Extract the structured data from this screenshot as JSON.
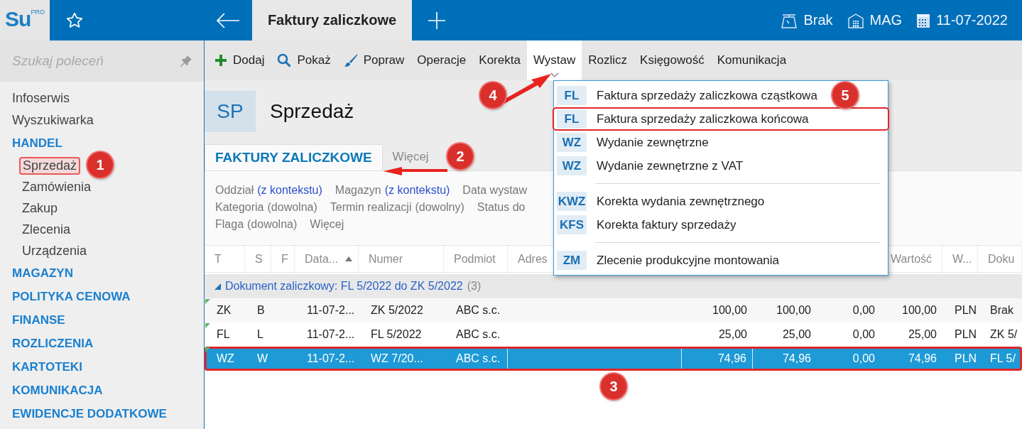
{
  "topbar": {
    "logo": {
      "text": "Su",
      "badge": "PRO"
    },
    "tab": {
      "title": "Faktury zaliczkowe",
      "selected": true
    },
    "status": [
      {
        "kind": "scale",
        "text": "Brak"
      },
      {
        "kind": "warehouse",
        "text": "MAG"
      },
      {
        "kind": "calendar",
        "text": "11-07-2022"
      }
    ]
  },
  "sidebar": {
    "search": {
      "placeholder": "Szukaj poleceń"
    },
    "items": [
      {
        "kind": "link",
        "label": "Infoserwis"
      },
      {
        "kind": "link",
        "label": "Wyszukiwarka"
      },
      {
        "kind": "section",
        "label": "HANDEL",
        "children": [
          {
            "label": "Sprzedaż",
            "selected": true
          },
          {
            "label": "Zamówienia",
            "selected": false
          },
          {
            "label": "Zakup",
            "selected": false
          },
          {
            "label": "Zlecenia",
            "selected": false
          },
          {
            "label": "Urządzenia",
            "selected": false
          }
        ]
      },
      {
        "kind": "section",
        "label": "MAGAZYN"
      },
      {
        "kind": "section",
        "label": "POLITYKA CENOWA"
      },
      {
        "kind": "section",
        "label": "FINANSE"
      },
      {
        "kind": "section",
        "label": "ROZLICZENIA"
      },
      {
        "kind": "section",
        "label": "KARTOTEKI"
      },
      {
        "kind": "section",
        "label": "KOMUNIKACJA"
      },
      {
        "kind": "section",
        "label": "EWIDENCJE DODATKOWE"
      }
    ]
  },
  "toolbar": [
    {
      "kind": "add",
      "label": "Dodaj",
      "selected": false
    },
    {
      "kind": "search",
      "label": "Pokaż",
      "selected": false
    },
    {
      "kind": "brush",
      "label": "Popraw",
      "selected": false
    },
    {
      "kind": "plain",
      "label": "Operacje",
      "selected": false
    },
    {
      "kind": "plain",
      "label": "Korekta",
      "selected": false
    },
    {
      "kind": "plain",
      "label": "Wystaw",
      "selected": true
    },
    {
      "kind": "plain",
      "label": "Rozlicz",
      "selected": false
    },
    {
      "kind": "plain",
      "label": "Księgowość",
      "selected": false
    },
    {
      "kind": "plain",
      "label": "Komunikacja",
      "selected": false
    }
  ],
  "header": {
    "badge": "SP",
    "title": "Sprzedaż"
  },
  "tabs": [
    {
      "label": "FAKTURY ZALICZKOWE",
      "selected": true
    },
    {
      "label": "Więcej",
      "selected": false
    }
  ],
  "filters": [
    [
      {
        "label": "Oddział",
        "value": "(z kontekstu)",
        "context": true
      },
      {
        "label": "Magazyn",
        "value": "(z kontekstu)",
        "context": true
      },
      {
        "label": "Data wystaw"
      }
    ],
    [
      {
        "label": "Kategoria",
        "value": "(dowolna)",
        "context": false
      },
      {
        "label": "Termin realizacji",
        "value": "(dowolny)",
        "context": false
      },
      {
        "label": "Status do"
      }
    ],
    [
      {
        "label": "Flaga",
        "value": "(dowolna)",
        "context": false
      },
      {
        "label": "Więcej"
      }
    ]
  ],
  "table": {
    "columns": [
      {
        "label": "T"
      },
      {
        "label": "S"
      },
      {
        "label": "F"
      },
      {
        "label": "Data...",
        "sorted": true
      },
      {
        "label": "Numer"
      },
      {
        "label": "Podmiot"
      },
      {
        "label": "Adres"
      },
      {},
      {},
      {},
      {
        "label": "Wartość"
      },
      {
        "label": "W..."
      },
      {
        "label": "Doku"
      }
    ],
    "group": {
      "label": "Dokument zaliczkowy: FL 5/2022 do ZK 5/2022",
      "count": "(3)",
      "expanded": true
    },
    "rows": [
      {
        "marked": true,
        "selected": false,
        "cells": [
          "ZK",
          "B",
          null,
          "11-07-2...",
          "ZK 5/2022",
          "ABC s.c.",
          null,
          "100,00",
          "100,00",
          "0,00",
          "100,00",
          "PLN",
          "Brak"
        ]
      },
      {
        "marked": true,
        "selected": false,
        "cells": [
          "FL",
          "L",
          null,
          "11-07-2...",
          "FL 5/2022",
          "ABC s.c.",
          null,
          "25,00",
          "25,00",
          "0,00",
          "25,00",
          "PLN",
          "ZK 5/"
        ]
      },
      {
        "marked": true,
        "selected": true,
        "cells": [
          "WZ",
          "W",
          null,
          "11-07-2...",
          "WZ 7/20...",
          "ABC s.c.",
          null,
          "74,96",
          "74,96",
          "0,00",
          "74,96",
          "PLN",
          "FL 5/"
        ]
      }
    ]
  },
  "menu": {
    "groups": [
      [
        {
          "code": "FL",
          "label": "Faktura sprzedaży zaliczkowa cząstkowa",
          "selected": false
        },
        {
          "code": "FL",
          "label": "Faktura sprzedaży zaliczkowa końcowa",
          "selected": true
        },
        {
          "code": "WZ",
          "label": "Wydanie zewnętrzne",
          "selected": false
        },
        {
          "code": "WZ",
          "label": "Wydanie zewnętrzne z VAT",
          "selected": false
        }
      ],
      [
        {
          "code": "KWZ",
          "label": "Korekta wydania zewnętrznego",
          "selected": false
        },
        {
          "code": "KFS",
          "label": "Korekta faktury sprzedaży",
          "selected": false
        }
      ],
      [
        {
          "code": "ZM",
          "label": "Zlecenie produkcyjne montowania",
          "selected": false
        }
      ]
    ]
  },
  "callouts": [
    "1",
    "2",
    "3",
    "4",
    "5"
  ]
}
